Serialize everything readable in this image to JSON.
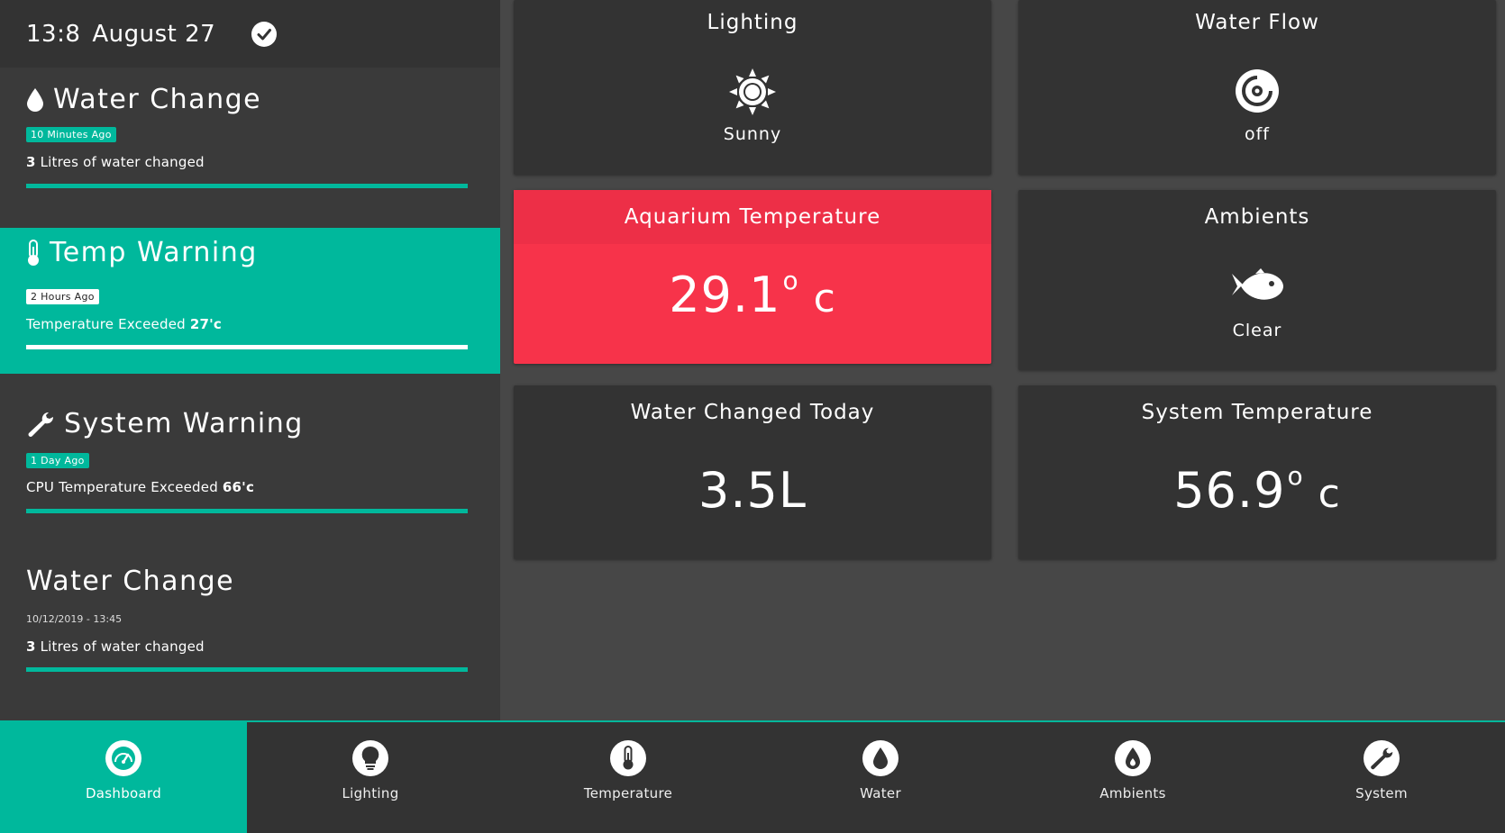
{
  "header": {
    "time": "13:8",
    "date": "August 27",
    "status_icon": "check-circle-icon"
  },
  "alerts": [
    {
      "title": "Water Change",
      "icon": "droplet-icon",
      "badge": "10 Minutes Ago",
      "message_prefix": "3",
      "message_text": " Litres of water changed",
      "progress": 1.0
    },
    {
      "title": "Temp Warning",
      "icon": "thermometer-icon",
      "badge": "2 Hours Ago",
      "message_text": "Temperature Exceeded ",
      "message_value": "27'c",
      "progress": 1.0,
      "active": true
    },
    {
      "title": "System Warning",
      "icon": "wrench-icon",
      "badge": "1 Day Ago",
      "message_text": "CPU Temperature Exceeded ",
      "message_value": "66'c",
      "progress": 1.0
    },
    {
      "title": "Water Change",
      "date": "10/12/2019 - 13:45",
      "message_prefix": "3",
      "message_text": " Litres of water changed",
      "progress": 1.0
    }
  ],
  "cards": {
    "lighting": {
      "title": "Lighting",
      "icon": "sun-icon",
      "value": "Sunny"
    },
    "water_flow": {
      "title": "Water Flow",
      "icon": "flow-disc-icon",
      "value": "off"
    },
    "aquarium_temp": {
      "title": "Aquarium Temperature",
      "value": "29.1",
      "degree": "o",
      "unit": "c",
      "color": "#f7334a"
    },
    "ambients": {
      "title": "Ambients",
      "icon": "fish-icon",
      "value": "Clear"
    },
    "water_changed": {
      "title": "Water Changed Today",
      "value": "3.5L"
    },
    "system_temp": {
      "title": "System Temperature",
      "value": "56.9",
      "degree": "o",
      "unit": "c"
    }
  },
  "nav": [
    {
      "label": "Dashboard",
      "icon": "speedometer-icon",
      "active": true
    },
    {
      "label": "Lighting",
      "icon": "lightbulb-icon"
    },
    {
      "label": "Temperature",
      "icon": "thermometer-icon"
    },
    {
      "label": "Water",
      "icon": "droplet-icon"
    },
    {
      "label": "Ambients",
      "icon": "flame-drop-icon"
    },
    {
      "label": "System",
      "icon": "wrench-icon"
    }
  ],
  "colors": {
    "accent": "#00b89c",
    "alert_red": "#f7334a",
    "panel": "#333333",
    "background": "#474747"
  }
}
